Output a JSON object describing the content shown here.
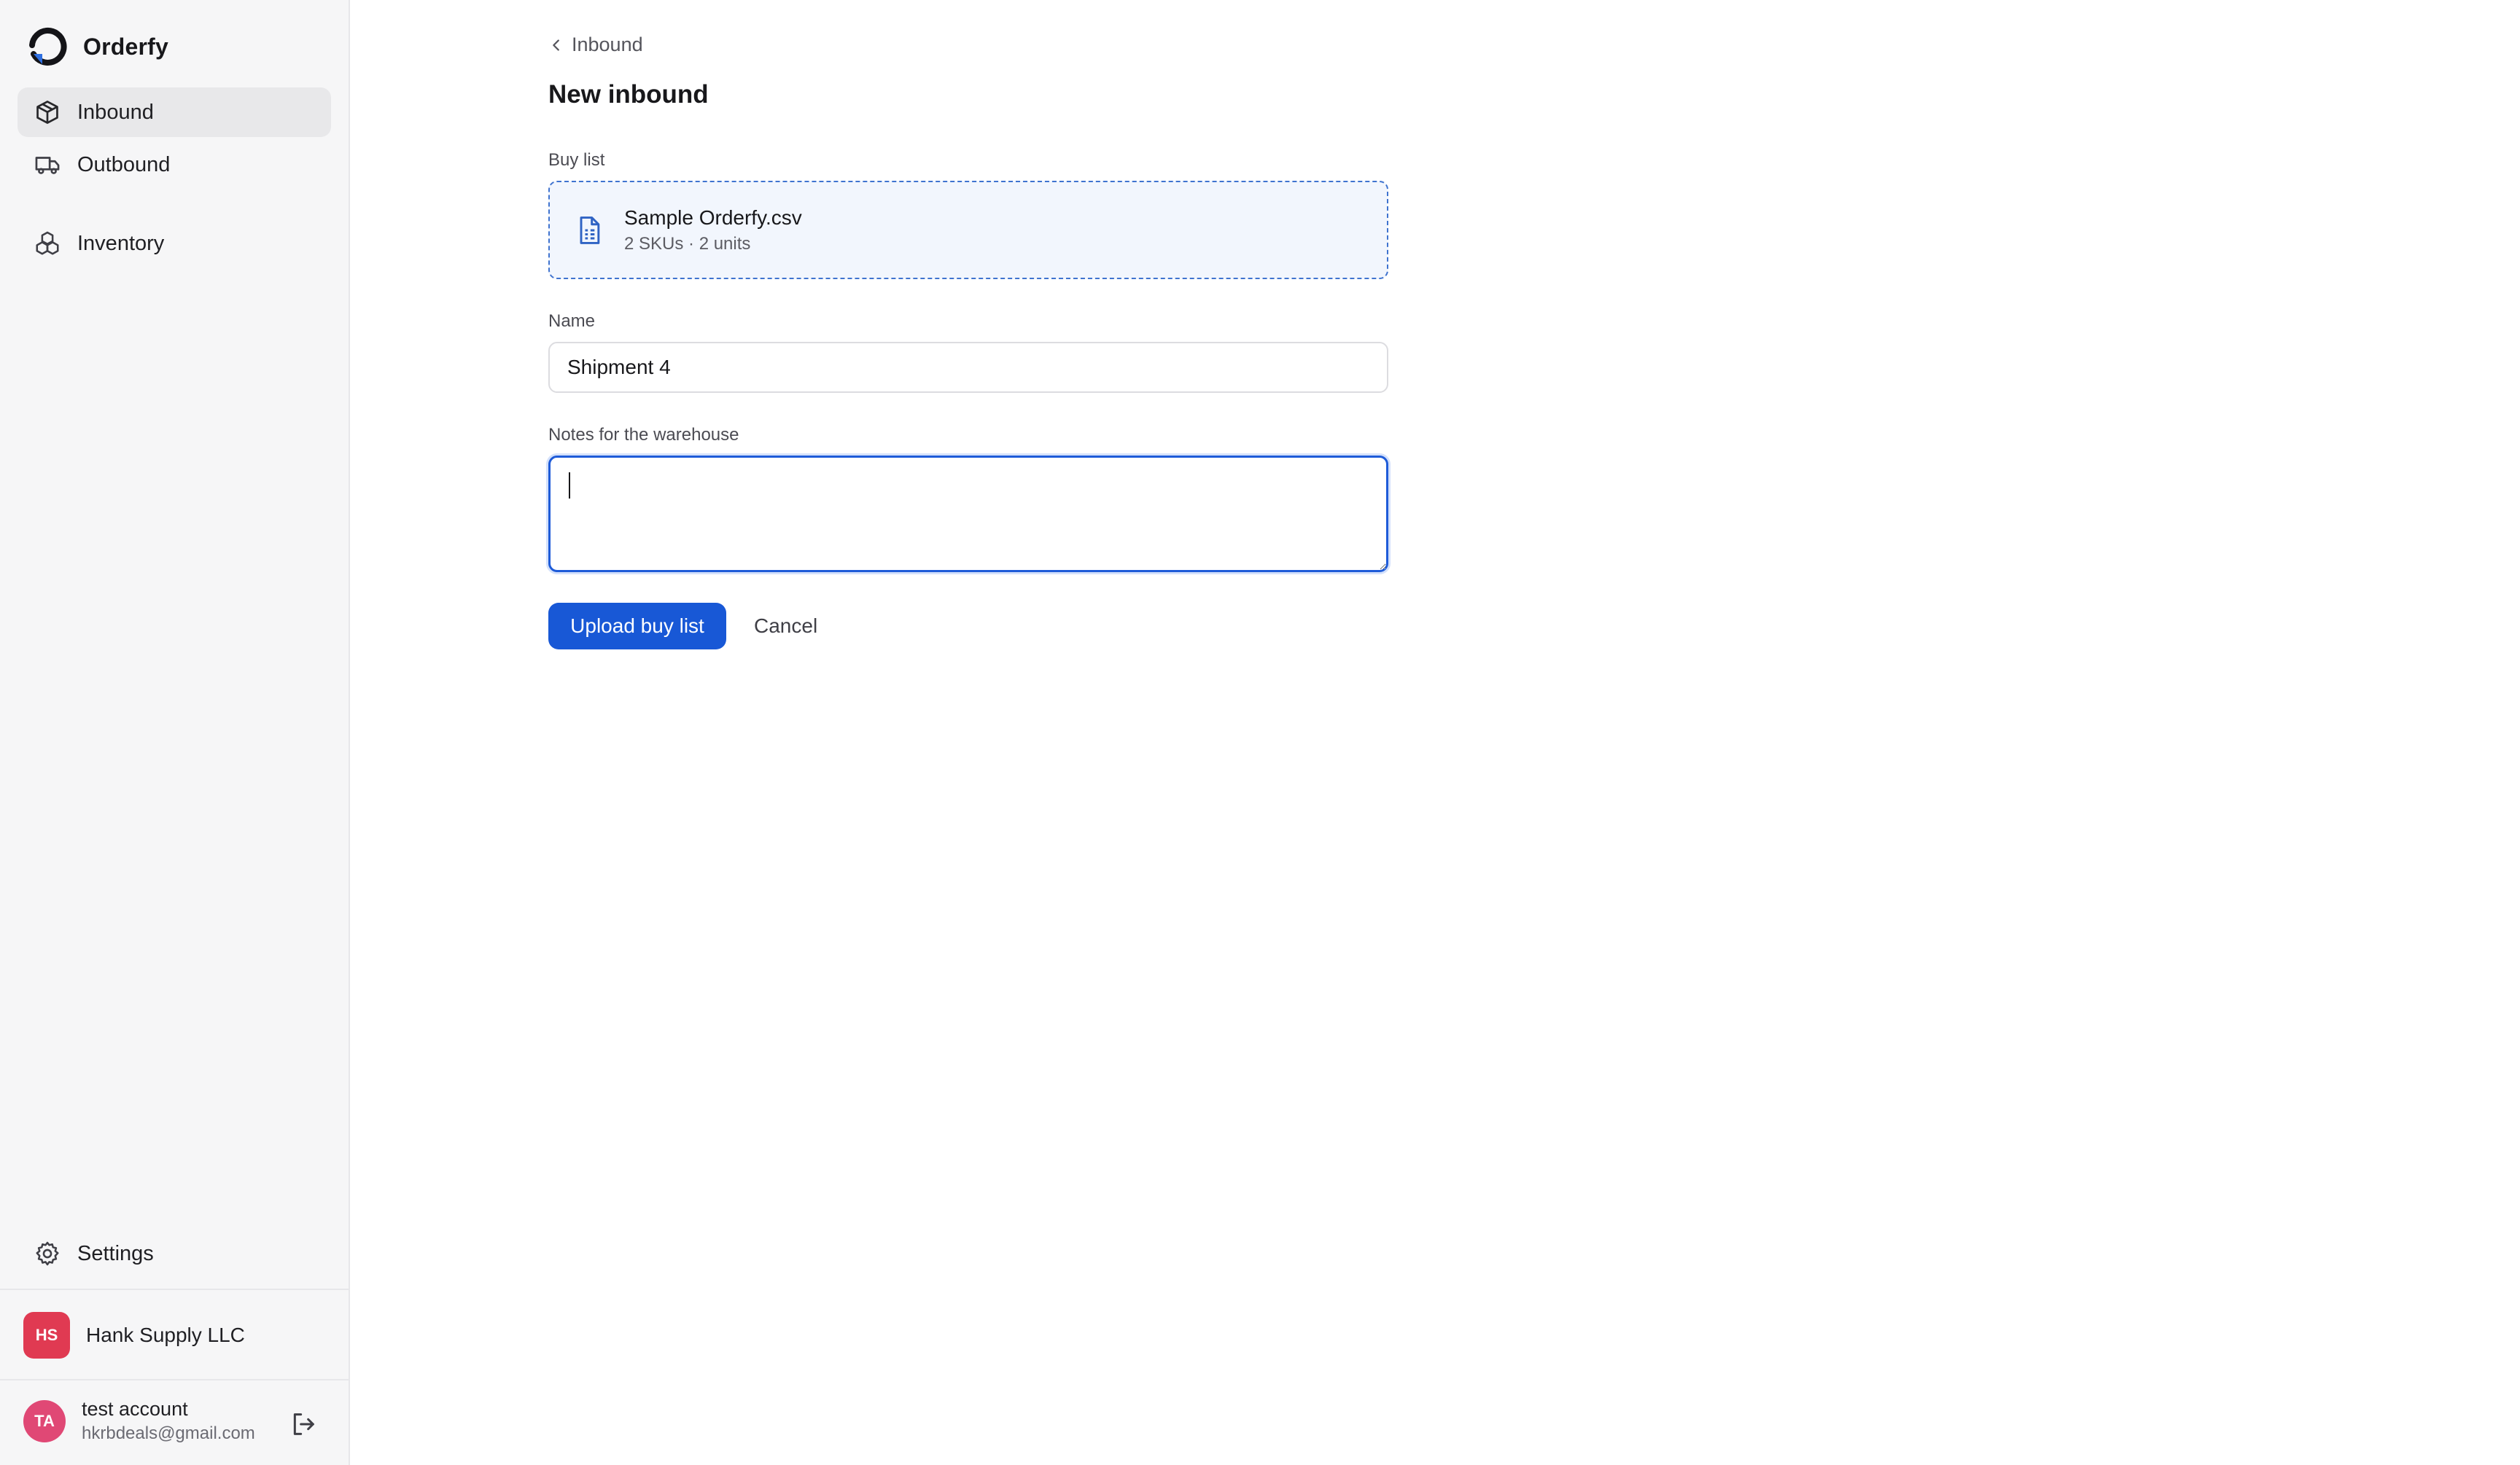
{
  "app": {
    "name": "Orderfy",
    "logo_icon": "orderfy-logo-icon",
    "accent_color": "#1858d6"
  },
  "sidebar": {
    "items": [
      {
        "label": "Inbound",
        "icon": "package-icon",
        "active": true
      },
      {
        "label": "Outbound",
        "icon": "truck-icon",
        "active": false
      },
      {
        "label": "Inventory",
        "icon": "boxes-icon",
        "active": false
      }
    ],
    "settings": {
      "label": "Settings",
      "icon": "gear-icon"
    },
    "organization": {
      "initials": "HS",
      "name": "Hank Supply LLC",
      "color": "#e03a52"
    },
    "user": {
      "initials": "TA",
      "name": "test account",
      "email": "hkrbdeals@gmail.com",
      "color": "#e04875"
    }
  },
  "main": {
    "breadcrumb": "Inbound",
    "title": "New inbound",
    "buy_list": {
      "label": "Buy list",
      "file_name": "Sample Orderfy.csv",
      "summary": "2 SKUs · 2 units"
    },
    "name_field": {
      "label": "Name",
      "value": "Shipment 4"
    },
    "notes_field": {
      "label": "Notes for the warehouse",
      "value": ""
    },
    "actions": {
      "submit": "Upload buy list",
      "cancel": "Cancel"
    }
  }
}
